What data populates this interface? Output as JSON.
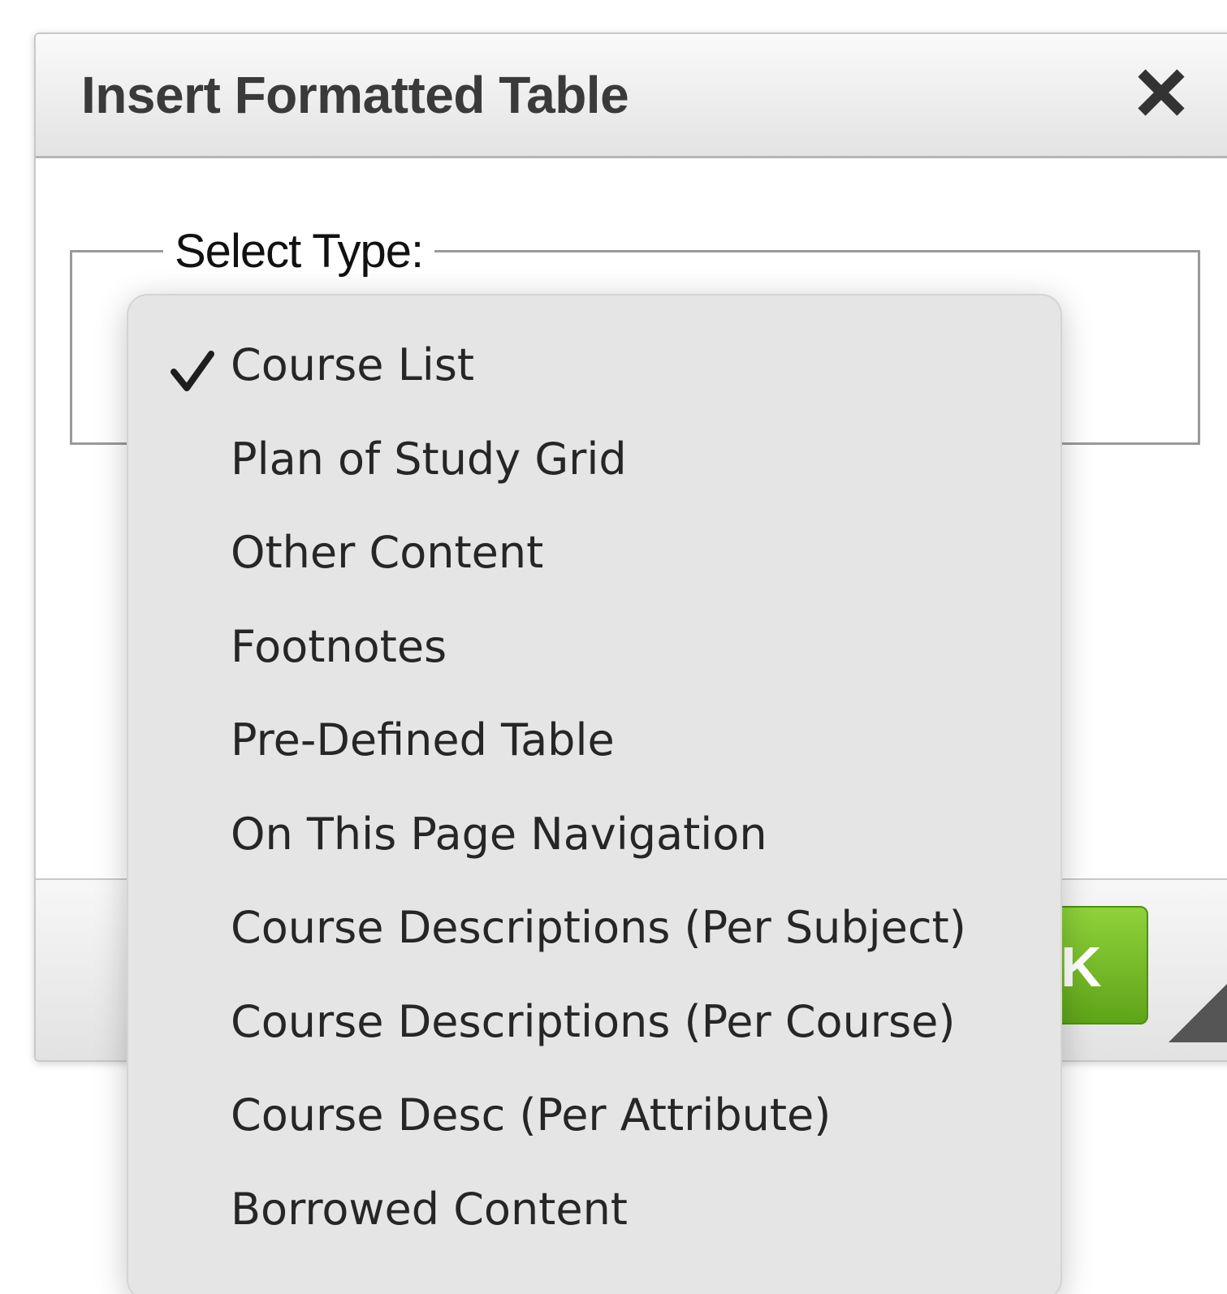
{
  "dialog": {
    "title": "Insert Formatted Table",
    "close_icon": "close-icon",
    "fieldset_legend": "Select Type:",
    "ok_button_label": "OK",
    "ok_button_color": "#6cb822"
  },
  "dropdown": {
    "selected": "Course List",
    "items": [
      {
        "label": "Course List",
        "checked": true
      },
      {
        "label": "Plan of Study Grid",
        "checked": false
      },
      {
        "label": "Other Content",
        "checked": false
      },
      {
        "label": "Footnotes",
        "checked": false
      },
      {
        "label": "Pre-Defined Table",
        "checked": false
      },
      {
        "label": "On This Page Navigation",
        "checked": false
      },
      {
        "label": "Course Descriptions (Per Subject)",
        "checked": false
      },
      {
        "label": "Course Descriptions (Per Course)",
        "checked": false
      },
      {
        "label": "Course Desc (Per Attribute)",
        "checked": false
      },
      {
        "label": "Borrowed Content",
        "checked": false
      }
    ],
    "check_icon": "checkmark-icon",
    "background_color": "#e5e5e5"
  }
}
